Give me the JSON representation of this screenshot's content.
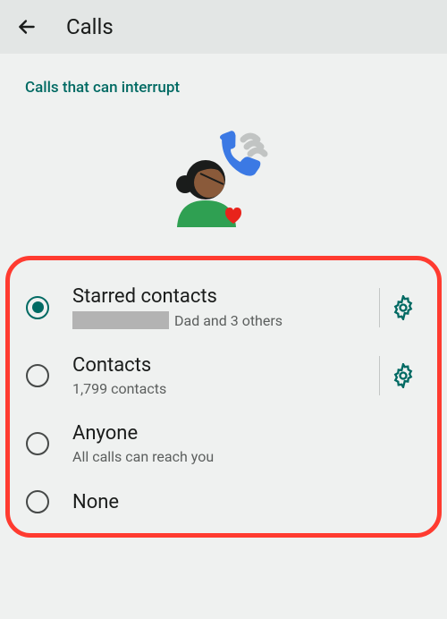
{
  "header": {
    "title": "Calls"
  },
  "subtitle": "Calls that can interrupt",
  "options": {
    "starred": {
      "title": "Starred contacts",
      "desc_suffix": "Dad and 3 others"
    },
    "contacts": {
      "title": "Contacts",
      "desc": "1,799 contacts"
    },
    "anyone": {
      "title": "Anyone",
      "desc": "All calls can reach you"
    },
    "none": {
      "title": "None"
    }
  },
  "colors": {
    "accent": "#006a63",
    "highlight_border": "#ff3b30"
  }
}
